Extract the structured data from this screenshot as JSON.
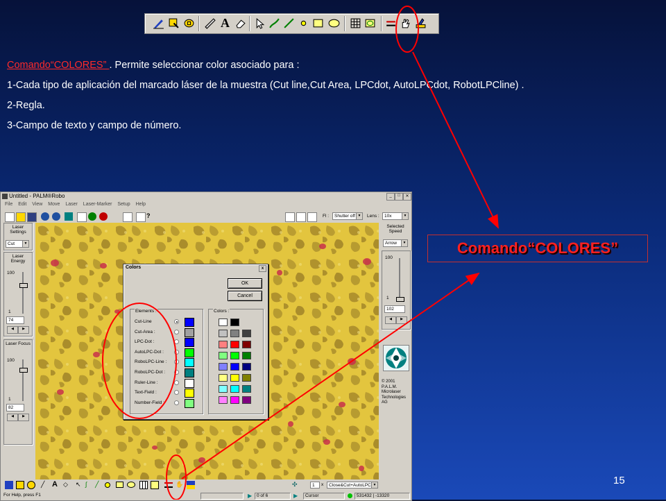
{
  "slide": {
    "command_link": "Comando“COLORES” ",
    "line1_rest": ". Permite seleccionar color asociado para :",
    "line2": "1-Cada tipo de aplicación del marcado láser de la muestra (Cut line,Cut Area, LPCdot, AutoLPCdot, RobotLPCline) .",
    "line3": "2-Regla.",
    "line4": "3-Campo de texto y campo de número.",
    "callout": "Comando“COLORES”",
    "page_number": "15"
  },
  "app": {
    "title": "Untitled - PALM®Robo",
    "menu": [
      "File",
      "Edit",
      "View",
      "Move",
      "Laser",
      "Laser-Marker",
      "Setup",
      "Help"
    ],
    "fl_label": "Fl :",
    "fl_value": "Shutter off",
    "lens_label": "Lens :",
    "lens_value": "10x",
    "left_panel": {
      "laser_settings": "Laser Settings",
      "cut_value": "Cut",
      "laser_energy": "Laser Energy",
      "energy_top": "100",
      "energy_bottom": "1",
      "energy_value": "74",
      "laser_focus": "Laser Focus",
      "focus_top": "100",
      "focus_bottom": "1",
      "focus_value": "82"
    },
    "right_panel": {
      "selected_speed": "Selected Speed",
      "speed_mode": "Arrow",
      "speed_top": "100",
      "speed_bottom": "1",
      "speed_value": "102",
      "copyright": "© 2001 P.A.L.M. Microlaser Technologies AG"
    },
    "bottom": {
      "page_box": "1",
      "close_x": "x",
      "mode_value": "Close&Cut+AutoLPC",
      "help": "For Help, press F1",
      "nav": "0 of 6",
      "cursor": "Cursor",
      "coords": "531432 | -13320"
    }
  },
  "dialog": {
    "title": "Colors",
    "close": "x",
    "ok": "OK",
    "cancel": "Cancel",
    "elements_label": "Elements :",
    "colors_label": "Colors :",
    "elements": [
      {
        "label": "Cut-Line",
        "color": "#0000ff",
        "selected": true
      },
      {
        "label": "Cut-Area :",
        "color": "#a0a0a0",
        "selected": false
      },
      {
        "label": "LPC-Dot :",
        "color": "#0000ff",
        "selected": false
      },
      {
        "label": "AutoLPC-Dot :",
        "color": "#00ff00",
        "selected": false
      },
      {
        "label": "RoboLPC-Line :",
        "color": "#00ffff",
        "selected": false
      },
      {
        "label": "RoboLPC-Dot :",
        "color": "#008080",
        "selected": false
      },
      {
        "label": "Ruler-Line :",
        "color": "#ffffff",
        "selected": false
      },
      {
        "label": "Text-Field :",
        "color": "#ffff00",
        "selected": false
      },
      {
        "label": "Number-Field :",
        "color": "#80ff80",
        "selected": false
      }
    ],
    "palette": [
      [
        "#ffffff",
        "#000000"
      ],
      [
        "#c0c0c0",
        "#808080",
        "#404040"
      ],
      [
        "#ff8080",
        "#ff0000",
        "#800000"
      ],
      [
        "#80ff80",
        "#00ff00",
        "#008000"
      ],
      [
        "#8080ff",
        "#0000ff",
        "#000080"
      ],
      [
        "#ffff80",
        "#ffff00",
        "#808000"
      ],
      [
        "#80ffff",
        "#00ffff",
        "#008080"
      ],
      [
        "#ff80ff",
        "#ff00ff",
        "#800080"
      ]
    ]
  },
  "annotation_color": "#ff0000"
}
